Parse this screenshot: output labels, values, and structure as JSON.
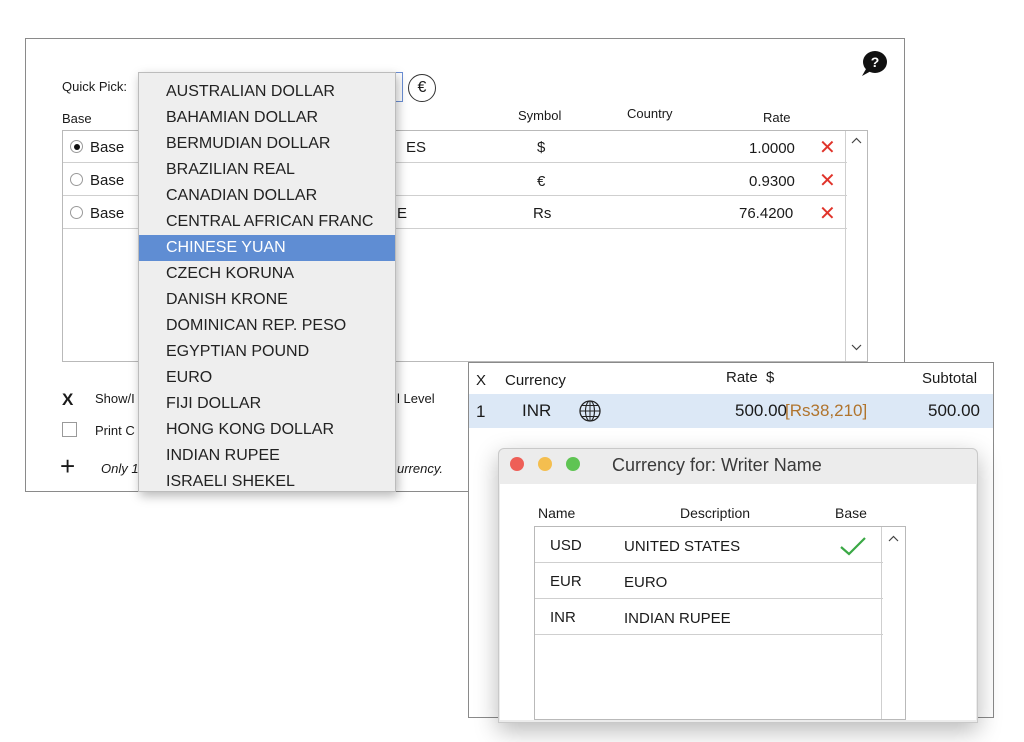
{
  "main_panel": {
    "quick_pick_label": "Quick Pick:",
    "columns": {
      "base": "Base",
      "symbol": "Symbol",
      "country": "Country",
      "rate": "Rate"
    },
    "rows": [
      {
        "base": "Base",
        "selected": true,
        "name_suffix": "ES",
        "symbol": "$",
        "rate": "1.0000"
      },
      {
        "base": "Base",
        "selected": false,
        "name_suffix": "",
        "symbol": "€",
        "rate": "0.9300"
      },
      {
        "base": "Base",
        "selected": false,
        "name_suffix": "E",
        "symbol": "Rs",
        "rate": "76.4200"
      }
    ],
    "option_show": "Show/I",
    "option_show_suffix": "l Level",
    "option_show_checked": true,
    "option_print": "Print C",
    "option_print_checked": false,
    "note_prefix": "Only 1",
    "note_suffix": "urrency.",
    "euro_glyph": "€",
    "help_glyph": "?",
    "add_glyph": "+"
  },
  "dropdown": {
    "items": [
      "AUSTRALIAN DOLLAR",
      "BAHAMIAN DOLLAR",
      "BERMUDIAN DOLLAR",
      "BRAZILIAN REAL",
      "CANADIAN DOLLAR",
      "CENTRAL AFRICAN FRANC",
      "CHINESE YUAN",
      "CZECH KORUNA",
      "DANISH KRONE",
      "DOMINICAN REP. PESO",
      "EGYPTIAN POUND",
      "EURO",
      "FIJI DOLLAR",
      "HONG KONG DOLLAR",
      "INDIAN RUPEE",
      "ISRAELI SHEKEL"
    ],
    "selected_index": 6
  },
  "line_table": {
    "columns": {
      "x": "X",
      "currency": "Currency",
      "rate": "Rate  $",
      "subtotal": "Subtotal"
    },
    "row": {
      "x": "1",
      "currency": "INR",
      "rate": "500.00",
      "converted": "[Rs38,210]",
      "subtotal": "500.00"
    }
  },
  "dialog": {
    "title": "Currency for: Writer Name",
    "columns": {
      "name": "Name",
      "description": "Description",
      "base": "Base"
    },
    "rows": [
      {
        "name": "USD",
        "description": "UNITED STATES",
        "base": true
      },
      {
        "name": "EUR",
        "description": "EURO",
        "base": false
      },
      {
        "name": "INR",
        "description": "INDIAN RUPEE",
        "base": false
      }
    ],
    "traffic_light_colors": {
      "close": "#ee5f57",
      "minimize": "#f4be4f",
      "zoom": "#5fc453"
    }
  },
  "colors": {
    "selection": "#5f8dd3",
    "delete": "#e0332a",
    "check": "#3aa845",
    "converted": "#b0742d",
    "highlight_row": "#dce8f6"
  }
}
